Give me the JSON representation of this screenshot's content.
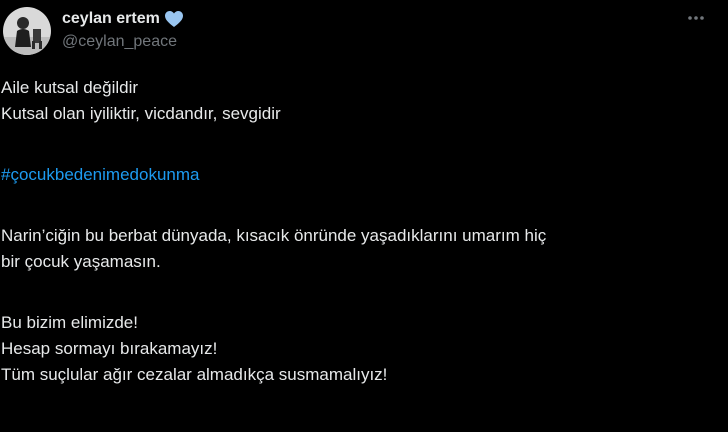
{
  "author": {
    "display_name": "ceylan ertem",
    "handle": "@ceylan_peace",
    "avatar_icon": "person-photo-avatar",
    "badge_icon": "blue-heart-icon",
    "badge_color": "#99c5f0"
  },
  "menu": {
    "icon": "more-options-icon"
  },
  "tweet": {
    "lines": [
      "Aile kutsal değildir",
      "Kutsal olan iyiliktir, vicdandır, sevgidir",
      "#çocukbedenimedokunma",
      "Narin’ciğin bu berbat dünyada, kısacık önründe yaşadıklarını umarım hiç",
      "bir çocuk yaşamasın.",
      "Bu bizim elimizde!",
      "Hesap sormayı bırakamayız!",
      "Tüm suçlular ağır cezalar almadıkça susmamalıyız!"
    ],
    "hashtag_color": "#1d9bf0"
  },
  "colors": {
    "background": "#000000",
    "text": "#e7e9ea",
    "muted": "#71767b"
  }
}
